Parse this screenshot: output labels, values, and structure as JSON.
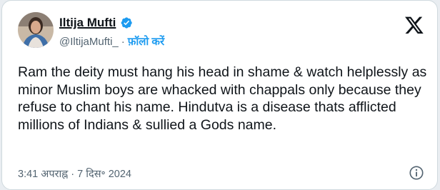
{
  "author": {
    "display_name": "Iltija Mufti",
    "handle": "@IltijaMufti_",
    "separator": "·",
    "follow_label": "फ़ॉलो करें"
  },
  "tweet": {
    "text": "Ram the deity must hang his head in shame & watch helplessly as minor Muslim boys are whacked with chappals only because they refuse to chant his name. Hindutva is a disease thats afflicted millions of Indians & sullied a Gods name.",
    "timestamp": "3:41 अपराह्न · 7 दिस॰ 2024"
  },
  "icons": {
    "verified": "verified-badge-icon",
    "platform": "x-logo-icon",
    "info": "info-icon"
  },
  "colors": {
    "accent": "#1d9bf0",
    "text": "#0f1419",
    "secondary": "#536471"
  }
}
